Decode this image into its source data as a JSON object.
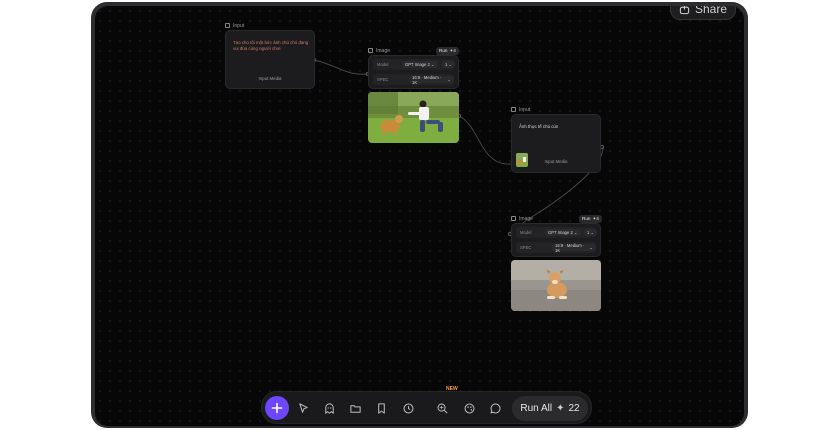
{
  "share_label": "Share",
  "nodes": [
    {
      "id": "input-1",
      "type_label": "Input",
      "prompt": "Tạo cho tôi một bức ảnh chú chó đang vui đùa cùng người chơi",
      "media_label": "Input Media"
    },
    {
      "id": "image-1",
      "type_label": "Image",
      "run_label": "Run",
      "run_cost": "4",
      "model_label": "Model",
      "model_value": "GPT Image 2",
      "count_value": "1",
      "spec_label": "SPEC",
      "spec_value": "16:9 · Medium · 1K",
      "output_image": "dog-playing-with-man-photo"
    },
    {
      "id": "input-2",
      "type_label": "Input",
      "prompt": "Ảnh thực tế chú cún",
      "media_label": "Input Media",
      "media_thumb": "dog-playing-thumbnail"
    },
    {
      "id": "image-2",
      "type_label": "Image",
      "run_label": "Run",
      "run_cost": "4",
      "model_label": "Model",
      "model_value": "GPT Image 2",
      "count_value": "1",
      "spec_label": "SPEC",
      "spec_value": "16:9 · Medium · 1K",
      "output_image": "puppy-realistic-photo"
    }
  ],
  "toolbar": {
    "tools": [
      "add",
      "select",
      "assistant",
      "folder",
      "bookmark",
      "history",
      "ai-search",
      "palette",
      "chat"
    ],
    "new_badge": "NEW",
    "run_all_label": "Run All",
    "run_all_cost": "22"
  },
  "colors": {
    "accent": "#6c47ff",
    "canvas": "#070707",
    "new_badge": "#ff9a3c",
    "prompt_text": "#d77b6f"
  }
}
